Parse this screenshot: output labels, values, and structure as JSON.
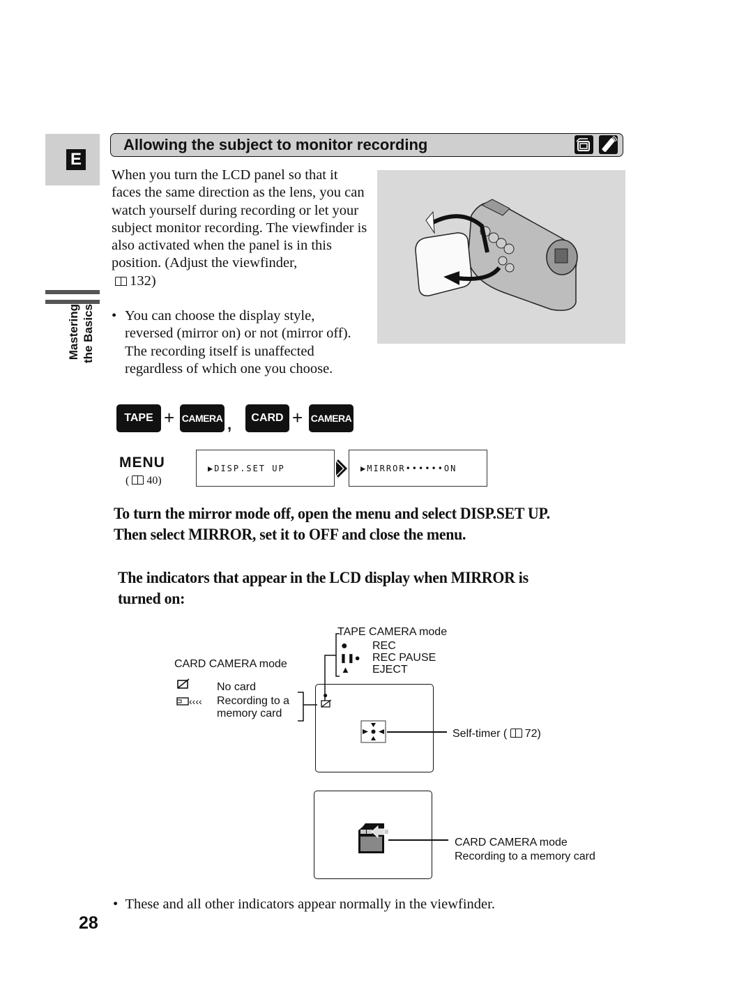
{
  "side_tab": {
    "language_letter": "E",
    "section_label_line1": "Mastering",
    "section_label_line2": "the Basics"
  },
  "header": {
    "title": "Allowing the subject to monitor recording",
    "icons": [
      "camcorder-icon",
      "remote-control-icon"
    ]
  },
  "intro": {
    "paragraph": "When you turn the LCD panel so that it faces the same direction as the lens, you can watch yourself during recording or let your subject monitor recording. The viewfinder is also activated when the panel is in this position. (Adjust the viewfinder,",
    "page_ref": "132)",
    "bullet": "You can choose the display style, reversed (mirror on) or not (mirror off). The recording itself is unaffected regardless of which one you choose."
  },
  "illustration": {
    "description": "camcorder with LCD panel rotated toward the lens"
  },
  "modes": {
    "tape": "TAPE",
    "camera1": "CAMERA",
    "card": "CARD",
    "camera2": "CAMERA",
    "plus": "+",
    "separator": ","
  },
  "menu": {
    "label": "MENU",
    "page_ref": "( 40)",
    "page_ref_num": "40)",
    "step1": "▶DISP.SET UP",
    "step2": "▶MIRROR••••••ON"
  },
  "instruction": {
    "line1": "To turn the mirror mode off, open the menu and select DISP.SET UP.",
    "line2": "Then select MIRROR, set it to OFF and close the menu."
  },
  "indicators_heading": {
    "line1": "The indicators that appear in the LCD display when MIRROR is",
    "line2": "turned on:"
  },
  "diagram": {
    "tape_mode_title": "TAPE CAMERA mode",
    "tape_items": [
      {
        "icon": "●",
        "label": "REC"
      },
      {
        "icon": "❚❚●",
        "label": "REC PAUSE"
      },
      {
        "icon": "▲",
        "label": "EJECT"
      }
    ],
    "card_mode_title": "CARD CAMERA mode",
    "card_items": [
      {
        "label": "No card"
      },
      {
        "label": "Recording to a",
        "label2": "memory card"
      }
    ],
    "self_timer_label": "Self-timer (",
    "self_timer_ref": "72)",
    "card_recording_line1": "CARD CAMERA mode",
    "card_recording_line2": "Recording to a memory card"
  },
  "footnote": "These and all other indicators appear normally in the viewfinder.",
  "page_number": "28"
}
